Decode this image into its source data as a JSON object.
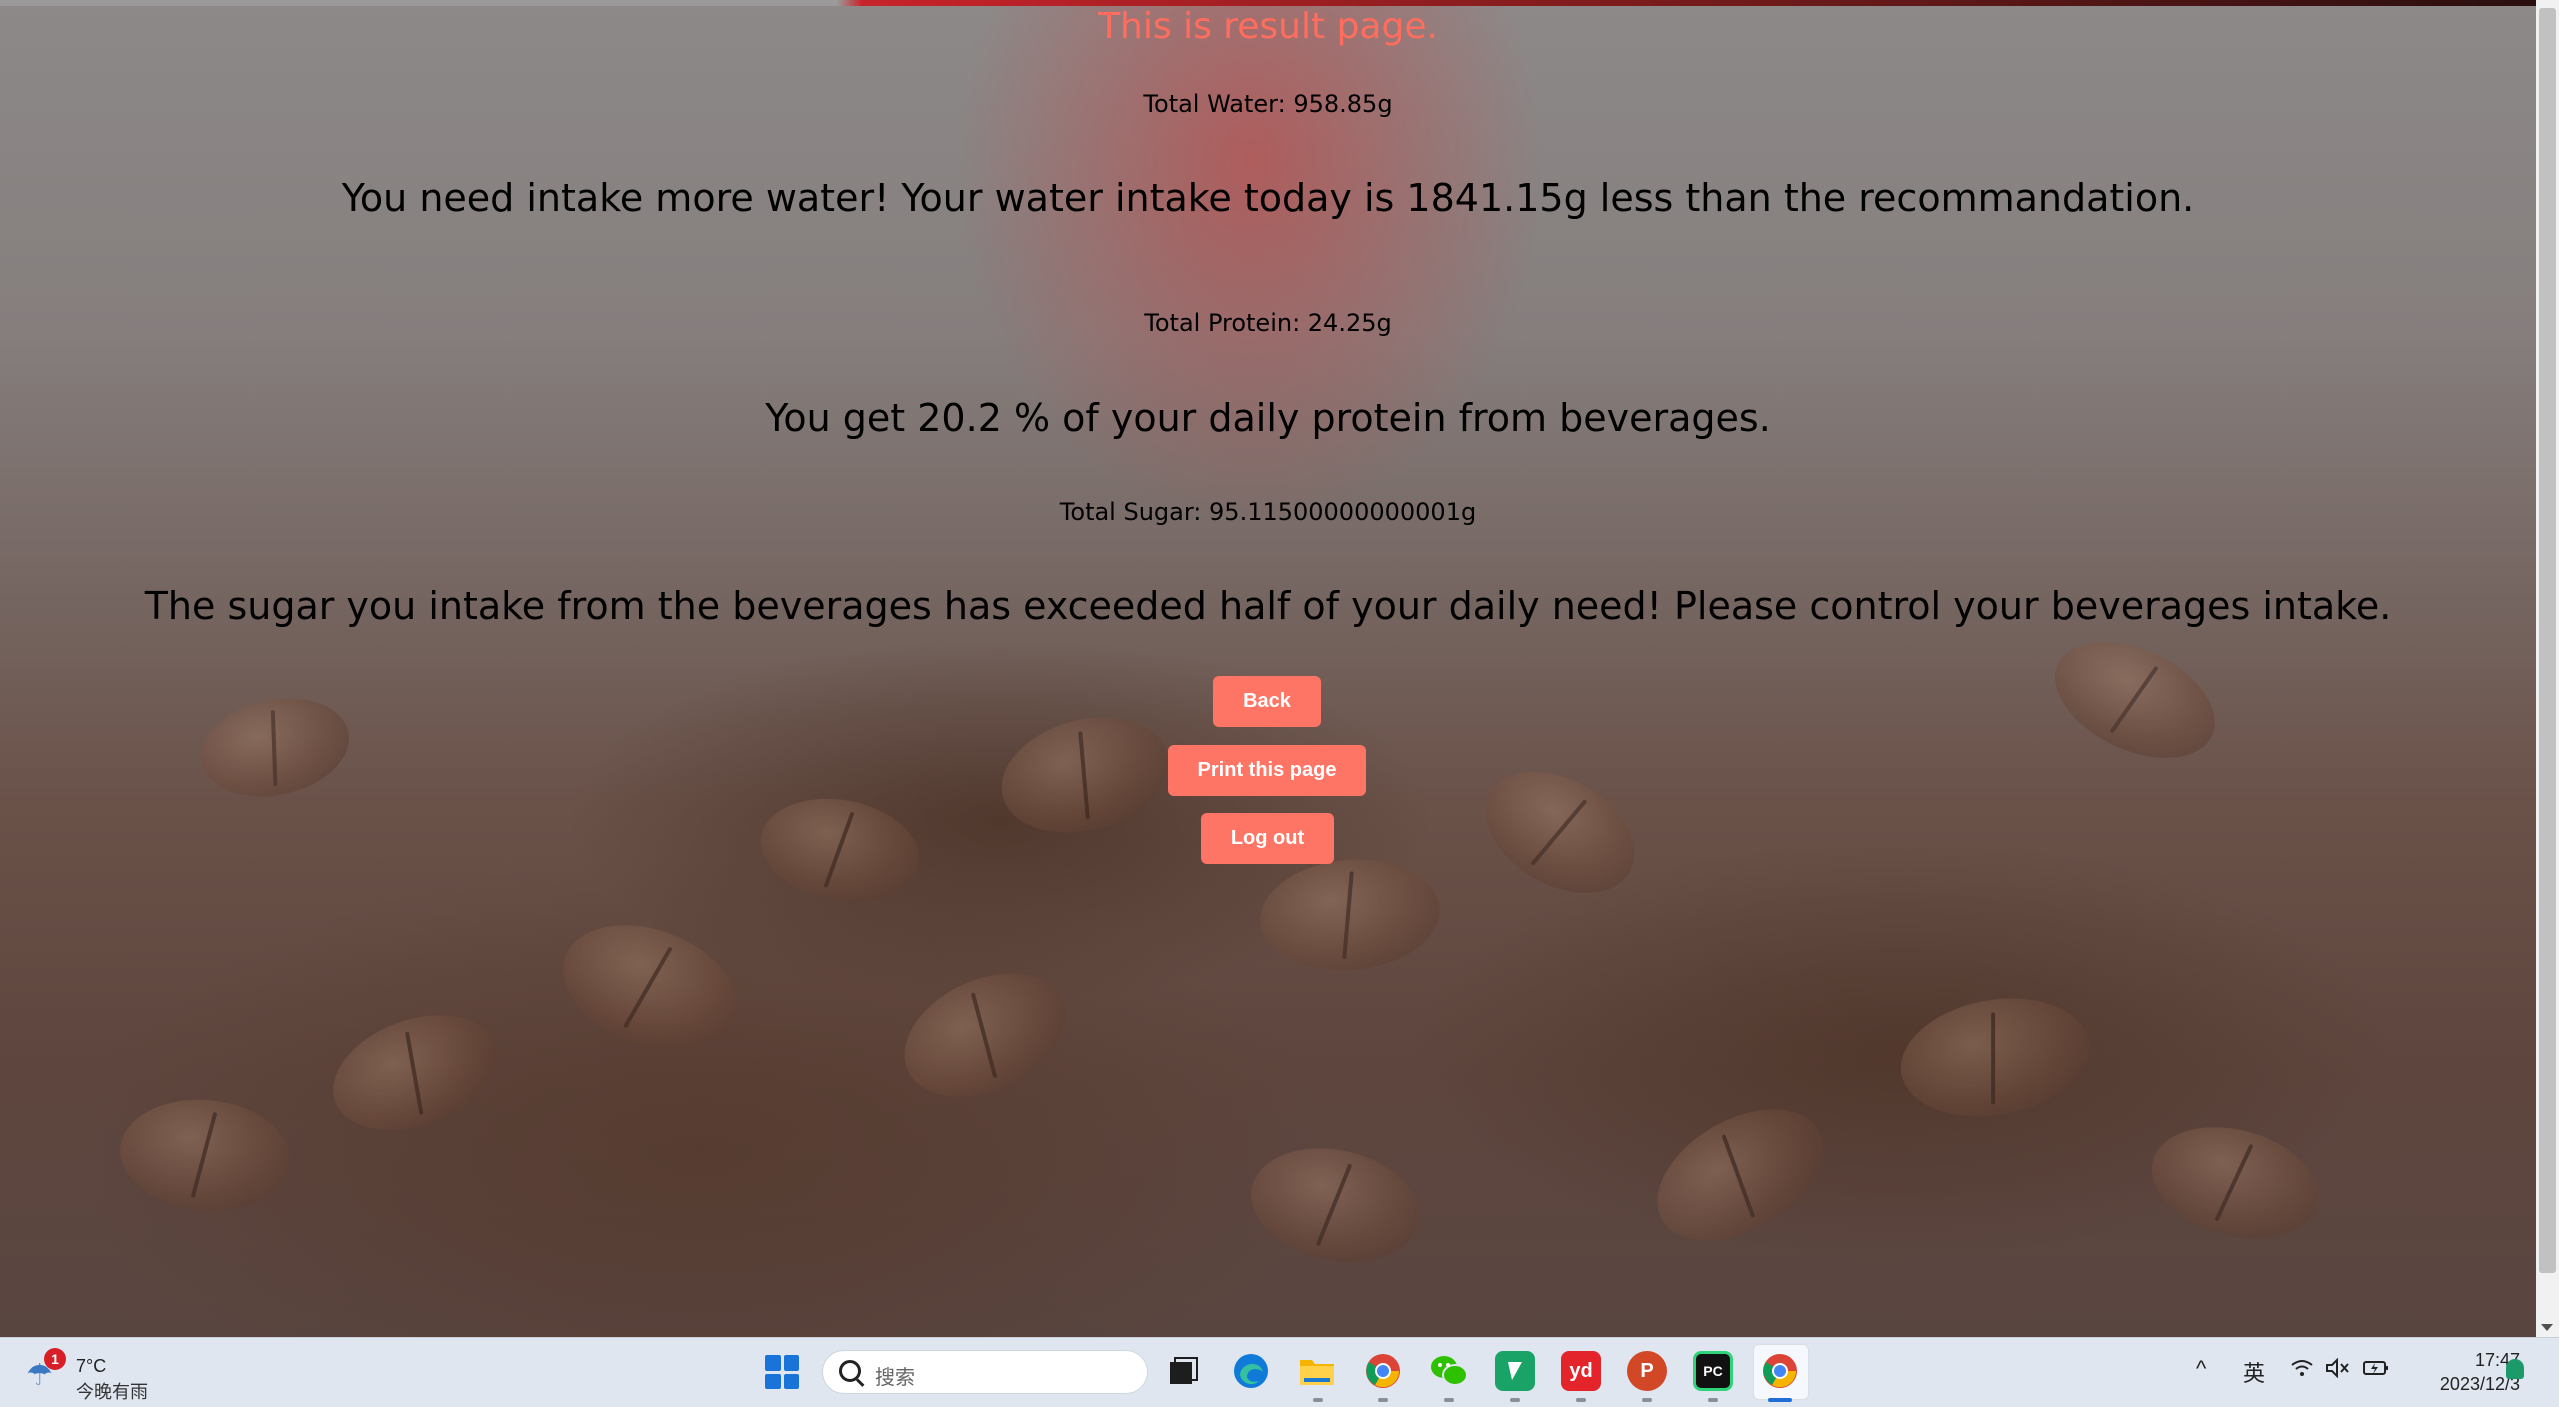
{
  "page": {
    "title": "This is result page.",
    "water_total": "Total Water: 958.85g",
    "water_message": "You need intake more water! Your water intake today is 1841.15g less than the recommandation.",
    "protein_total": "Total Protein: 24.25g",
    "protein_message": "You get 20.2 % of your daily protein from beverages.",
    "sugar_total": "Total Sugar: 95.11500000000001g",
    "sugar_message": "The sugar you intake from the beverages has exceeded half of your daily need! Please control your beverages intake.",
    "buttons": {
      "back": "Back",
      "print": "Print this page",
      "logout": "Log out"
    },
    "colors": {
      "title": "#ff6d5e",
      "button": "#ff7565"
    }
  },
  "taskbar": {
    "weather": {
      "badge": "1",
      "temp": "7°C",
      "desc": "今晚有雨",
      "icon": "umbrella-icon"
    },
    "search_placeholder": "搜索",
    "apps": [
      {
        "name": "task-view-icon"
      },
      {
        "name": "edge-icon"
      },
      {
        "name": "file-explorer-icon"
      },
      {
        "name": "chrome-icon"
      },
      {
        "name": "wechat-icon"
      },
      {
        "name": "green-app-icon"
      },
      {
        "name": "youdao-icon",
        "label": "yd"
      },
      {
        "name": "powerpoint-icon",
        "label": "P"
      },
      {
        "name": "pycharm-icon",
        "label": "PC"
      },
      {
        "name": "chrome-active-icon"
      }
    ],
    "tray": {
      "chevron": "^",
      "ime": "英",
      "time": "17:47",
      "date": "2023/12/3"
    }
  }
}
